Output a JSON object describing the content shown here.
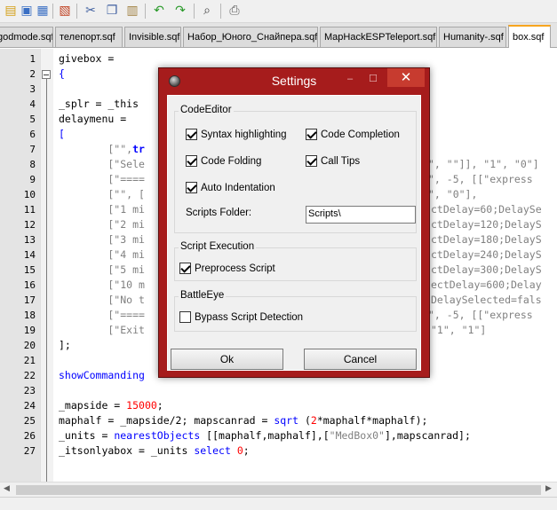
{
  "toolbar": {
    "icons": [
      "new-file-icon",
      "open-icon",
      "save-icon",
      "save-all-icon",
      "close-icon",
      "cut-icon",
      "copy-icon",
      "paste-icon",
      "undo-icon",
      "redo-icon",
      "find-icon",
      "print-icon"
    ]
  },
  "tabs": [
    {
      "label": "godmode.sqf",
      "active": false
    },
    {
      "label": "телепорт.sqf",
      "active": false
    },
    {
      "label": "Invisible.sqf",
      "active": false
    },
    {
      "label": "Набор_Юного_Снайпера.sqf",
      "active": false
    },
    {
      "label": "MapHackESPTeleport.sqf",
      "active": false
    },
    {
      "label": "Humanity-.sqf",
      "active": false
    },
    {
      "label": "box.sqf",
      "active": true
    }
  ],
  "editor": {
    "line_numbers": [
      "1",
      "2",
      "3",
      "4",
      "5",
      "6",
      "7",
      "8",
      "9",
      "10",
      "11",
      "12",
      "13",
      "14",
      "15",
      "16",
      "17",
      "18",
      "19",
      "20",
      "21",
      "22",
      "23",
      "24",
      "25",
      "26",
      "27"
    ],
    "lines": {
      "l1": "givebox =",
      "l2": "{",
      "l4a": "_splr = _this",
      "l5": "delaymenu =",
      "l6": "[",
      "l7a": "        [\"\",",
      "l7b": "tr",
      "l8a": "        [\"Sele",
      "l8r": "\", \"\"]], \"1\", \"0\"]",
      "l9a": "        [\"====",
      "l9r": "\", -5, [[\"express",
      "l10a": "        [\"\", [",
      "l10r": "\", \"0\"],",
      "l11a": "        [\"1 mi",
      "l11r": "ctDelay=60;DelaySe",
      "l12a": "        [\"2 mi",
      "l12r": "ctDelay=120;DelayS",
      "l13a": "        [\"3 mi",
      "l13r": "ctDelay=180;DelayS",
      "l14a": "        [\"4 mi",
      "l14r": "ctDelay=240;DelayS",
      "l15a": "        [\"5 mi",
      "l15r": "ctDelay=300;DelayS",
      "l16a": "        [\"10 m",
      "l16r": "ectDelay=600;Delay",
      "l17a": "        [\"No t",
      "l17r": "DelaySelected=fals",
      "l18a": "        [\"====",
      "l18r": "\", -5, [[\"express",
      "l19a": "        [\"Exit",
      "l19r": "\"1\", \"1\"]",
      "l20": "];",
      "l22a": "showCommanding",
      "l24a": "_mapside = ",
      "l24n": "15000",
      "l24b": ";",
      "l25a": "maphalf = _mapside/2; mapscanrad = ",
      "l25k": "sqrt",
      "l25b": " (",
      "l25n": "2",
      "l25c": "*maphalf*maphalf);",
      "l26a": "_units = ",
      "l26k": "nearestObjects",
      "l26b": " [[maphalf,maphalf],[",
      "l26s": "\"MedBox0\"",
      "l26c": "],mapscanrad];",
      "l27a": "_itsonlyabox = _units ",
      "l27k": "select",
      "l27b": " ",
      "l27n": "0",
      "l27c": ";"
    }
  },
  "dialog": {
    "title": "Settings",
    "close_glyph": "✕",
    "groups": {
      "code_editor": {
        "label": "CodeEditor",
        "syntax_highlighting": {
          "label": "Syntax highlighting",
          "checked": true
        },
        "code_completion": {
          "label": "Code Completion",
          "checked": true
        },
        "code_folding": {
          "label": "Code Folding",
          "checked": true
        },
        "call_tips": {
          "label": "Call Tips",
          "checked": true
        },
        "auto_indentation": {
          "label": "Auto Indentation",
          "checked": true
        },
        "scripts_folder_label": "Scripts Folder:",
        "scripts_folder_value": "Scripts\\"
      },
      "script_execution": {
        "label": "Script Execution",
        "preprocess_script": {
          "label": "Preprocess Script",
          "checked": true
        }
      },
      "battleye": {
        "label": "BattleEye",
        "bypass": {
          "label": "Bypass Script Detection",
          "checked": false
        }
      }
    },
    "ok_label": "Ok",
    "cancel_label": "Cancel"
  },
  "colors": {
    "dialog_frame": "#a61c1c",
    "close_button": "#c73b2f",
    "active_tab_accent": "#f7a51f",
    "string": "#808080",
    "number": "#ff0000",
    "keyword": "#0000ff"
  }
}
